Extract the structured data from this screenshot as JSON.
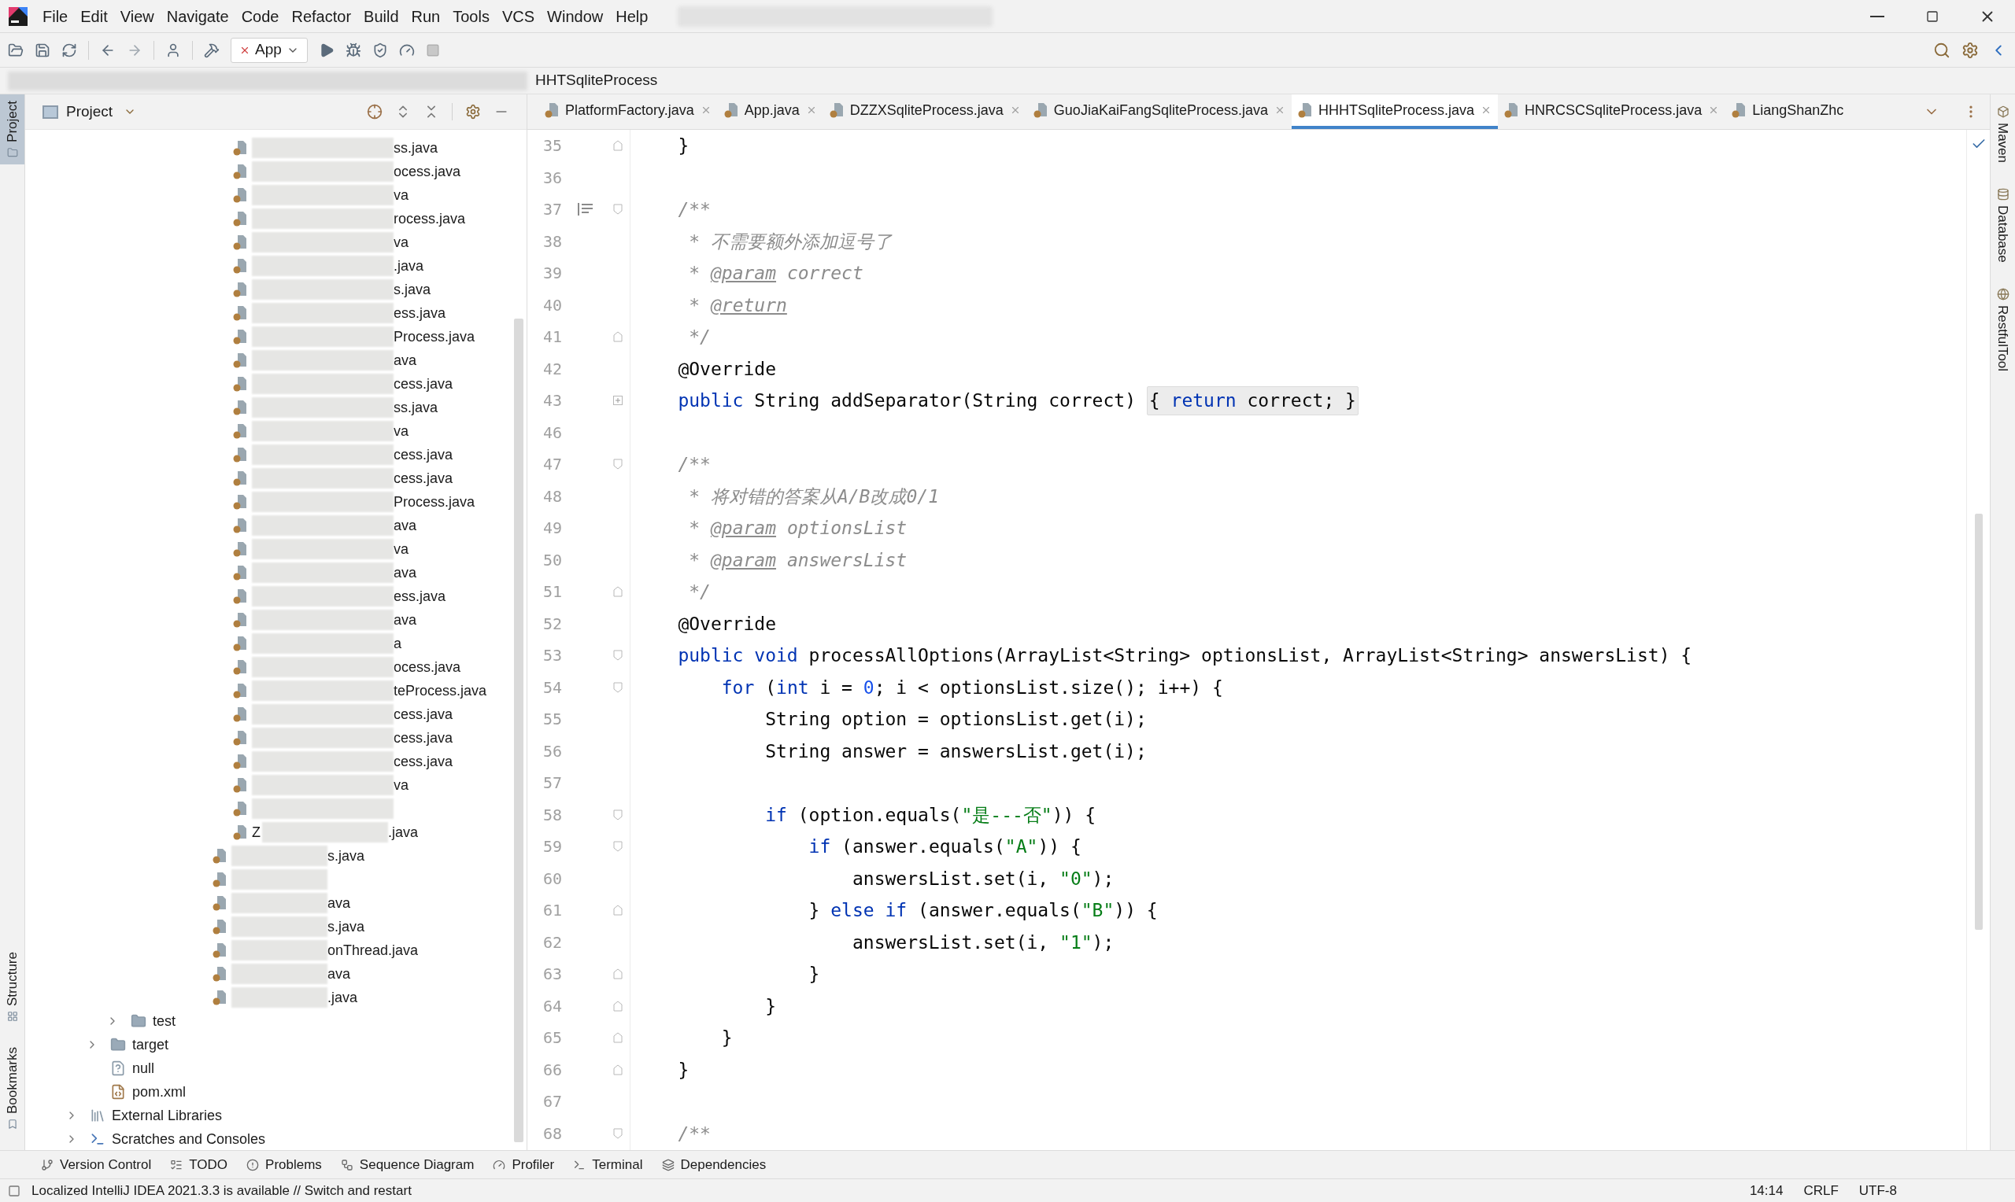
{
  "menu": [
    {
      "label": "File"
    },
    {
      "label": "Edit"
    },
    {
      "label": "View"
    },
    {
      "label": "Navigate"
    },
    {
      "label": "Code"
    },
    {
      "label": "Refactor"
    },
    {
      "label": "Build"
    },
    {
      "label": "Run"
    },
    {
      "label": "Tools"
    },
    {
      "label": "VCS"
    },
    {
      "label": "Window"
    },
    {
      "label": "Help"
    }
  ],
  "toolbar": {
    "run_config": "App"
  },
  "breadcrumb": "HHTSqliteProcess",
  "left_stripe": {
    "top": [
      {
        "label": "Project",
        "selected": true
      }
    ],
    "bottom": [
      {
        "label": "Structure",
        "selected": false
      },
      {
        "label": "Bookmarks",
        "selected": false
      }
    ]
  },
  "right_stripe": [
    {
      "label": "Maven",
      "selected": false
    },
    {
      "label": "Database",
      "selected": false
    },
    {
      "label": "RestfulTool",
      "selected": false
    }
  ],
  "project_panel": {
    "title": "Project"
  },
  "tree": [
    {
      "kind": "offscreen",
      "children": [
        {
          "kind": "offscreen",
          "children": [
            {
              "kind": "offscreen",
              "children": [
                {
                  "kind": "offscreen",
                  "children": [
                    {
                      "kind": "offscreen",
                      "children": [
                        {
                          "kind": "offscreen",
                          "children": [
                            {
                              "kind": "offscreen",
                              "children": [
                                {
                                  "kind": "java",
                                  "text": "ss.java"
                                },
                                {
                                  "kind": "java",
                                  "text": "ocess.java"
                                },
                                {
                                  "kind": "java",
                                  "text": "va"
                                },
                                {
                                  "kind": "java",
                                  "text": "rocess.java"
                                },
                                {
                                  "kind": "java",
                                  "text": "va"
                                },
                                {
                                  "kind": "java",
                                  "text": ".java"
                                },
                                {
                                  "kind": "java",
                                  "text": "s.java"
                                },
                                {
                                  "kind": "java",
                                  "text": "ess.java"
                                },
                                {
                                  "kind": "java",
                                  "text": "Process.java"
                                },
                                {
                                  "kind": "java",
                                  "text": "ava"
                                },
                                {
                                  "kind": "java",
                                  "text": "cess.java"
                                },
                                {
                                  "kind": "java",
                                  "text": "ss.java"
                                },
                                {
                                  "kind": "java",
                                  "text": "va"
                                },
                                {
                                  "kind": "java",
                                  "text": "cess.java"
                                },
                                {
                                  "kind": "java",
                                  "text": "cess.java"
                                },
                                {
                                  "kind": "java",
                                  "text": "Process.java"
                                },
                                {
                                  "kind": "java",
                                  "text": "ava"
                                },
                                {
                                  "kind": "java",
                                  "text": "va"
                                },
                                {
                                  "kind": "java",
                                  "text": "ava"
                                },
                                {
                                  "kind": "java",
                                  "text": "ess.java"
                                },
                                {
                                  "kind": "java",
                                  "text": "ava"
                                },
                                {
                                  "kind": "java",
                                  "text": "a"
                                },
                                {
                                  "kind": "java",
                                  "text": "ocess.java"
                                },
                                {
                                  "kind": "java",
                                  "text": "teProcess.java"
                                },
                                {
                                  "kind": "java",
                                  "text": "cess.java"
                                },
                                {
                                  "kind": "java",
                                  "text": "cess.java"
                                },
                                {
                                  "kind": "java",
                                  "text": "cess.java"
                                },
                                {
                                  "kind": "java",
                                  "text": "va"
                                },
                                {
                                  "kind": "java"
                                },
                                {
                                  "kind": "java",
                                  "prefix": "Z",
                                  "text": ".java"
                                }
                              ]
                            },
                            {
                              "kind": "java",
                              "text": "s.java"
                            },
                            {
                              "kind": "java"
                            },
                            {
                              "kind": "java",
                              "text": "ava"
                            },
                            {
                              "kind": "java",
                              "text": "s.java"
                            },
                            {
                              "kind": "java",
                              "text": "onThread.java"
                            },
                            {
                              "kind": "java",
                              "text": "ava"
                            },
                            {
                              "kind": "java",
                              "text": ".java"
                            }
                          ]
                        }
                      ]
                    }
                  ]
                }
              ]
            },
            {
              "kind": "folder",
              "label": "test",
              "expanded": false
            }
          ]
        },
        {
          "kind": "folder",
          "label": "target",
          "expanded": false
        },
        {
          "kind": "unknown",
          "label": "null"
        },
        {
          "kind": "maven",
          "label": "pom.xml"
        }
      ]
    },
    {
      "kind": "libraries",
      "label": "External Libraries",
      "expanded": false
    },
    {
      "kind": "scratches",
      "label": "Scratches and Consoles",
      "expanded": false
    }
  ],
  "editor_tabs": [
    {
      "label": "PlatformFactory.java",
      "selected": false,
      "closable": true
    },
    {
      "label": "App.java",
      "selected": false,
      "closable": true
    },
    {
      "label": "DZZXSqliteProcess.java",
      "selected": false,
      "closable": true
    },
    {
      "label": "GuoJiaKaiFangSqliteProcess.java",
      "selected": false,
      "closable": true
    },
    {
      "label": "HHHTSqliteProcess.java",
      "selected": true,
      "closable": true
    },
    {
      "label": "HNRCSCSqliteProcess.java",
      "selected": false,
      "closable": true
    },
    {
      "label": "LiangShanZhc",
      "selected": false,
      "closable": false
    }
  ],
  "code_lines": [
    {
      "number": "35",
      "fold_end": true,
      "segments": [
        {
          "kind": "plain",
          "text": "    }"
        }
      ]
    },
    {
      "number": "36"
    },
    {
      "number": "37",
      "fold_start": true,
      "doc_toggle": true,
      "segments": [
        {
          "kind": "cmt",
          "text": "    /**"
        }
      ]
    },
    {
      "number": "38",
      "segments": [
        {
          "kind": "cmt",
          "text": "     * 不需要额外添加逗号了"
        }
      ]
    },
    {
      "number": "39",
      "segments": [
        {
          "kind": "cmt",
          "text": "     * "
        },
        {
          "kind": "tag",
          "text": "@param"
        },
        {
          "kind": "cmt",
          "text": " correct"
        }
      ]
    },
    {
      "number": "40",
      "segments": [
        {
          "kind": "cmt",
          "text": "     * "
        },
        {
          "kind": "tag",
          "text": "@return"
        }
      ]
    },
    {
      "number": "41",
      "fold_end": true,
      "segments": [
        {
          "kind": "cmt",
          "text": "     */"
        }
      ]
    },
    {
      "number": "42",
      "segments": [
        {
          "kind": "plain",
          "text": "    @Override"
        }
      ]
    },
    {
      "number": "43",
      "folded": true,
      "segments": [
        {
          "kind": "kw",
          "text": "    public "
        },
        {
          "kind": "plain",
          "text": "String addSeparator(String correct) "
        },
        {
          "kind": "fold",
          "text": "{ "
        },
        {
          "kind": "foldkw",
          "text": "return"
        },
        {
          "kind": "fold",
          "text": " correct; }"
        }
      ]
    },
    {
      "number": "46"
    },
    {
      "number": "47",
      "fold_start": true,
      "segments": [
        {
          "kind": "cmt",
          "text": "    /**"
        }
      ]
    },
    {
      "number": "48",
      "segments": [
        {
          "kind": "cmt",
          "text": "     * 将对错的答案从A/B改成0/1"
        }
      ]
    },
    {
      "number": "49",
      "segments": [
        {
          "kind": "cmt",
          "text": "     * "
        },
        {
          "kind": "tag",
          "text": "@param"
        },
        {
          "kind": "cmt",
          "text": " optionsList"
        }
      ]
    },
    {
      "number": "50",
      "segments": [
        {
          "kind": "cmt",
          "text": "     * "
        },
        {
          "kind": "tag",
          "text": "@param"
        },
        {
          "kind": "cmt",
          "text": " answersList"
        }
      ]
    },
    {
      "number": "51",
      "fold_end": true,
      "segments": [
        {
          "kind": "cmt",
          "text": "     */"
        }
      ]
    },
    {
      "number": "52",
      "segments": [
        {
          "kind": "plain",
          "text": "    @Override"
        }
      ]
    },
    {
      "number": "53",
      "fold_start": true,
      "segments": [
        {
          "kind": "kw",
          "text": "    public void "
        },
        {
          "kind": "plain",
          "text": "processAllOptions(ArrayList<String> optionsList, ArrayList<String> answersList) {"
        }
      ]
    },
    {
      "number": "54",
      "fold_start": true,
      "segments": [
        {
          "kind": "kw",
          "text": "        for "
        },
        {
          "kind": "plain",
          "text": "("
        },
        {
          "kind": "kw",
          "text": "int "
        },
        {
          "kind": "plain",
          "text": "i = "
        },
        {
          "kind": "num",
          "text": "0"
        },
        {
          "kind": "plain",
          "text": "; i < optionsList.size(); i++) {"
        }
      ]
    },
    {
      "number": "55",
      "segments": [
        {
          "kind": "plain",
          "text": "            String option = optionsList.get(i);"
        }
      ]
    },
    {
      "number": "56",
      "segments": [
        {
          "kind": "plain",
          "text": "            String answer = answersList.get(i);"
        }
      ]
    },
    {
      "number": "57"
    },
    {
      "number": "58",
      "fold_start": true,
      "segments": [
        {
          "kind": "kw",
          "text": "            if "
        },
        {
          "kind": "plain",
          "text": "(option.equals("
        },
        {
          "kind": "str",
          "text": "\"是---否\""
        },
        {
          "kind": "plain",
          "text": ")) {"
        }
      ]
    },
    {
      "number": "59",
      "fold_start": true,
      "segments": [
        {
          "kind": "kw",
          "text": "                if "
        },
        {
          "kind": "plain",
          "text": "(answer.equals("
        },
        {
          "kind": "str",
          "text": "\"A\""
        },
        {
          "kind": "plain",
          "text": ")) {"
        }
      ]
    },
    {
      "number": "60",
      "segments": [
        {
          "kind": "plain",
          "text": "                    answersList.set(i, "
        },
        {
          "kind": "str",
          "text": "\"0\""
        },
        {
          "kind": "plain",
          "text": ");"
        }
      ]
    },
    {
      "number": "61",
      "fold_end": true,
      "segments": [
        {
          "kind": "plain",
          "text": "                } "
        },
        {
          "kind": "kw",
          "text": "else if "
        },
        {
          "kind": "plain",
          "text": "(answer.equals("
        },
        {
          "kind": "str",
          "text": "\"B\""
        },
        {
          "kind": "plain",
          "text": ")) {"
        }
      ]
    },
    {
      "number": "62",
      "segments": [
        {
          "kind": "plain",
          "text": "                    answersList.set(i, "
        },
        {
          "kind": "str",
          "text": "\"1\""
        },
        {
          "kind": "plain",
          "text": ");"
        }
      ]
    },
    {
      "number": "63",
      "fold_end": true,
      "segments": [
        {
          "kind": "plain",
          "text": "                }"
        }
      ]
    },
    {
      "number": "64",
      "fold_end": true,
      "segments": [
        {
          "kind": "plain",
          "text": "            }"
        }
      ]
    },
    {
      "number": "65",
      "fold_end": true,
      "segments": [
        {
          "kind": "plain",
          "text": "        }"
        }
      ]
    },
    {
      "number": "66",
      "fold_end": true,
      "segments": [
        {
          "kind": "plain",
          "text": "    }"
        }
      ]
    },
    {
      "number": "67"
    },
    {
      "number": "68",
      "fold_start": true,
      "segments": [
        {
          "kind": "cmt",
          "text": "    /**"
        }
      ]
    }
  ],
  "tool_tabs": [
    {
      "label": "Version Control",
      "selected": false
    },
    {
      "label": "TODO",
      "selected": false
    },
    {
      "label": "Problems",
      "selected": false
    },
    {
      "label": "Sequence Diagram",
      "selected": false
    },
    {
      "label": "Profiler",
      "selected": false
    },
    {
      "label": "Terminal",
      "selected": false
    },
    {
      "label": "Dependencies",
      "selected": false
    }
  ],
  "status_bar": {
    "message": "Localized IntelliJ IDEA 2021.3.3 is available // Switch and restart",
    "position": "14:14",
    "line_separator": "CRLF",
    "encoding": "UTF-8"
  }
}
